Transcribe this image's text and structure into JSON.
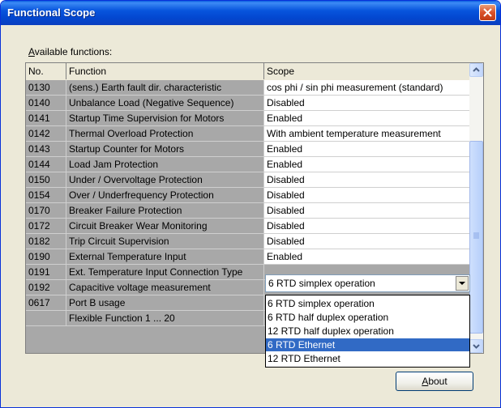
{
  "window": {
    "title": "Functional Scope"
  },
  "label": {
    "available_prefix": "A",
    "available_rest": "vailable functions:"
  },
  "table": {
    "headers": {
      "no": "No.",
      "function": "Function",
      "scope": "Scope"
    },
    "rows": [
      {
        "no": "0130",
        "function": "(sens.) Earth fault dir. characteristic",
        "scope": "cos phi / sin phi measurement (standard)"
      },
      {
        "no": "0140",
        "function": "Unbalance Load (Negative Sequence)",
        "scope": "Disabled"
      },
      {
        "no": "0141",
        "function": "Startup Time Supervision for Motors",
        "scope": "Enabled"
      },
      {
        "no": "0142",
        "function": "Thermal Overload Protection",
        "scope": "With ambient temperature measurement"
      },
      {
        "no": "0143",
        "function": "Startup Counter for Motors",
        "scope": "Enabled"
      },
      {
        "no": "0144",
        "function": "Load Jam Protection",
        "scope": "Enabled"
      },
      {
        "no": "0150",
        "function": "Under / Overvoltage Protection",
        "scope": "Disabled"
      },
      {
        "no": "0154",
        "function": "Over / Underfrequency Protection",
        "scope": "Disabled"
      },
      {
        "no": "0170",
        "function": "Breaker Failure Protection",
        "scope": "Disabled"
      },
      {
        "no": "0172",
        "function": "Circuit Breaker Wear Monitoring",
        "scope": "Disabled"
      },
      {
        "no": "0182",
        "function": "Trip Circuit Supervision",
        "scope": "Disabled"
      },
      {
        "no": "0190",
        "function": "External Temperature Input",
        "scope": "Enabled"
      },
      {
        "no": "0191",
        "function": "Ext. Temperature Input Connection Type",
        "scope": ""
      },
      {
        "no": "0192",
        "function": "Capacitive voltage measurement",
        "scope": ""
      },
      {
        "no": "0617",
        "function": "Port B usage",
        "scope": ""
      },
      {
        "no": "",
        "function": "Flexible Function 1 ... 20",
        "scope": ""
      }
    ]
  },
  "combo": {
    "value": "6 RTD simplex operation"
  },
  "dropdown": {
    "options": [
      "6 RTD simplex operation",
      "6 RTD half duplex operation",
      "12 RTD half duplex operation",
      "6 RTD Ethernet",
      "12 RTD Ethernet"
    ],
    "selected": "6 RTD Ethernet"
  },
  "buttons": {
    "about_prefix": "A",
    "about_rest": "bout"
  },
  "colors": {
    "titlebar": "#0a50d8",
    "selection": "#316ac5",
    "body": "#ece9d8"
  }
}
